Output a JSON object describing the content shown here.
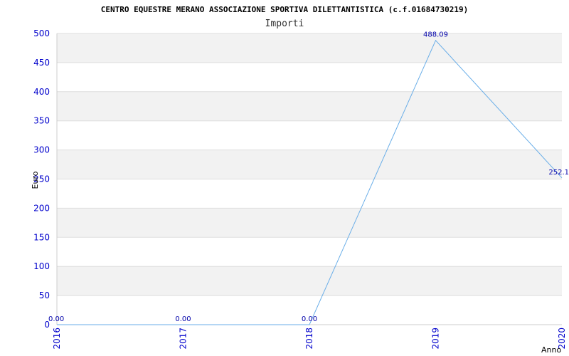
{
  "chart_data": {
    "type": "line",
    "title": "CENTRO EQUESTRE MERANO ASSOCIAZIONE SPORTIVA DILETTANTISTICA (c.f.01684730219)",
    "subtitle": "Importi",
    "xlabel": "Anno",
    "ylabel": "Euro",
    "categories": [
      "2016",
      "2017",
      "2018",
      "2019",
      "2020"
    ],
    "values": [
      0.0,
      0.0,
      0.0,
      488.09,
      252.1
    ],
    "data_labels": [
      "0.00",
      "0.00",
      "0.00",
      "488.09",
      "252.1"
    ],
    "ylim": [
      0,
      500
    ],
    "yticks": [
      0,
      50,
      100,
      150,
      200,
      250,
      300,
      350,
      400,
      450,
      500
    ],
    "grid": true,
    "colors": {
      "line": "#6aaee8",
      "band": "#f2f2f2",
      "tick_text": "#0000cc",
      "data_label": "#0000aa"
    }
  }
}
